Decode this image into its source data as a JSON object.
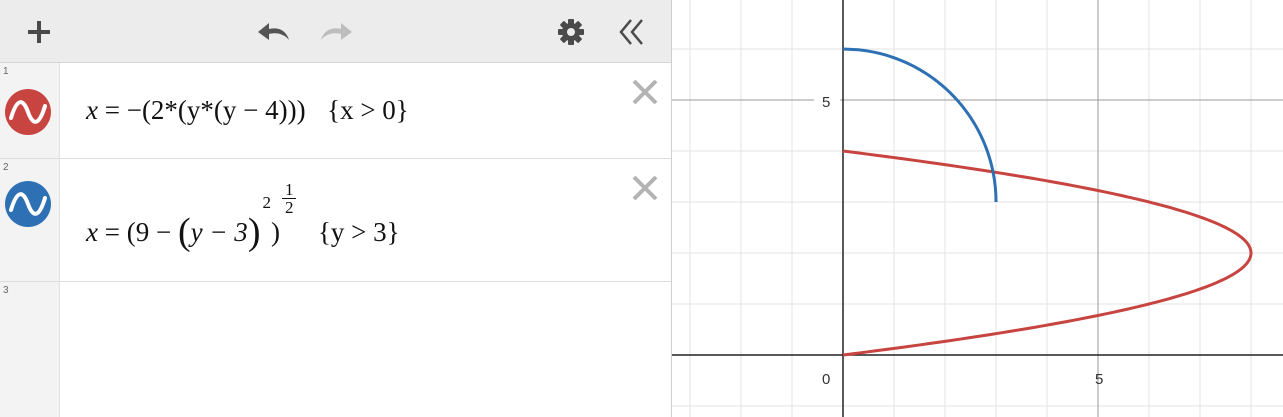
{
  "toolbar": {
    "add_icon": "plus-icon",
    "undo_icon": "undo-icon",
    "redo_icon": "redo-icon",
    "settings_icon": "gear-icon",
    "collapse_icon": "double-chevron-left-icon"
  },
  "expressions": [
    {
      "index": "1",
      "color": "#c74440",
      "lhs": "x",
      "eq": "=",
      "rhs_text": "−(2*(y*(y − 4)))",
      "restriction": "{x > 0}"
    },
    {
      "index": "2",
      "color": "#2d70b3",
      "lhs": "x",
      "eq": "=",
      "base": "(9 − ",
      "inner": "y − 3",
      "inner_exp": "2",
      "close": ")",
      "exp_num": "1",
      "exp_den": "2",
      "restriction": "{y  >  3}"
    },
    {
      "index": "3"
    }
  ],
  "graph": {
    "tick_labels": {
      "origin": "0",
      "x5": "5",
      "y5": "5"
    },
    "curve_colors": {
      "red": "#c74440",
      "blue": "#2d70b3"
    }
  }
}
